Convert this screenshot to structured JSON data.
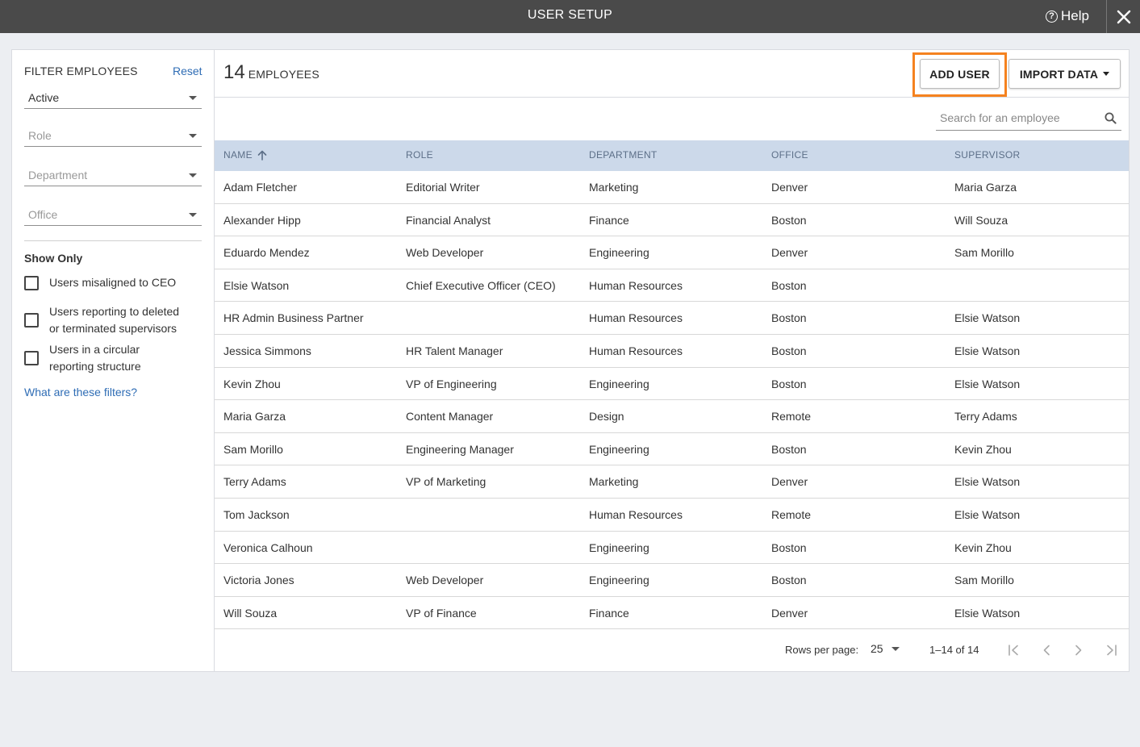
{
  "window": {
    "title": "USER SETUP",
    "help_label": "Help"
  },
  "sidebar": {
    "filter_heading": "FILTER EMPLOYEES",
    "reset_label": "Reset",
    "status_select": "Active",
    "role_placeholder": "Role",
    "department_placeholder": "Department",
    "office_placeholder": "Office",
    "show_only_heading": "Show Only",
    "checkboxes": [
      {
        "label_line1": "Users misaligned to CEO",
        "label_line2": "",
        "checked": false
      },
      {
        "label_line1": "Users reporting to deleted",
        "label_line2": "or terminated supervisors",
        "checked": false
      },
      {
        "label_line1": "Users in a circular",
        "label_line2": "reporting structure",
        "checked": false
      }
    ],
    "filters_help_link": "What are these filters?"
  },
  "main": {
    "employee_count": "14",
    "employee_count_label": "EMPLOYEES",
    "add_user_label": "ADD USER",
    "import_data_label": "IMPORT DATA",
    "search_placeholder": "Search for an employee"
  },
  "table": {
    "columns": [
      "NAME",
      "ROLE",
      "DEPARTMENT",
      "OFFICE",
      "SUPERVISOR"
    ],
    "sort_indicator": "ascending",
    "rows": [
      [
        "Adam Fletcher",
        "Editorial Writer",
        "Marketing",
        "Denver",
        "Maria Garza"
      ],
      [
        "Alexander Hipp",
        "Financial Analyst",
        "Finance",
        "Boston",
        "Will Souza"
      ],
      [
        "Eduardo Mendez",
        "Web Developer",
        "Engineering",
        "Denver",
        "Sam Morillo"
      ],
      [
        "Elsie Watson",
        "Chief Executive Officer (CEO)",
        "Human Resources",
        "Boston",
        ""
      ],
      [
        "HR Admin Business Partner",
        "",
        "Human Resources",
        "Boston",
        "Elsie Watson"
      ],
      [
        "Jessica Simmons",
        "HR Talent Manager",
        "Human Resources",
        "Boston",
        "Elsie Watson"
      ],
      [
        "Kevin Zhou",
        "VP of Engineering",
        "Engineering",
        "Boston",
        "Elsie Watson"
      ],
      [
        "Maria Garza",
        "Content Manager",
        "Design",
        "Remote",
        "Terry Adams"
      ],
      [
        "Sam Morillo",
        "Engineering Manager",
        "Engineering",
        "Boston",
        "Kevin Zhou"
      ],
      [
        "Terry Adams",
        "VP of Marketing",
        "Marketing",
        "Denver",
        "Elsie Watson"
      ],
      [
        "Tom Jackson",
        "",
        "Human Resources",
        "Remote",
        "Elsie Watson"
      ],
      [
        "Veronica Calhoun",
        "",
        "Engineering",
        "Boston",
        "Kevin Zhou"
      ],
      [
        "Victoria Jones",
        "Web Developer",
        "Engineering",
        "Boston",
        "Sam Morillo"
      ],
      [
        "Will Souza",
        "VP of Finance",
        "Finance",
        "Denver",
        "Elsie Watson"
      ]
    ]
  },
  "pagination": {
    "rows_per_page_label": "Rows per page:",
    "rows_per_page_value": "25",
    "range_label": "1–14 of 14"
  },
  "colors": {
    "titlebar": "#4a4a4a",
    "header_row": "#ccd9ea",
    "link": "#2f6db5",
    "highlight": "#f5821f"
  }
}
